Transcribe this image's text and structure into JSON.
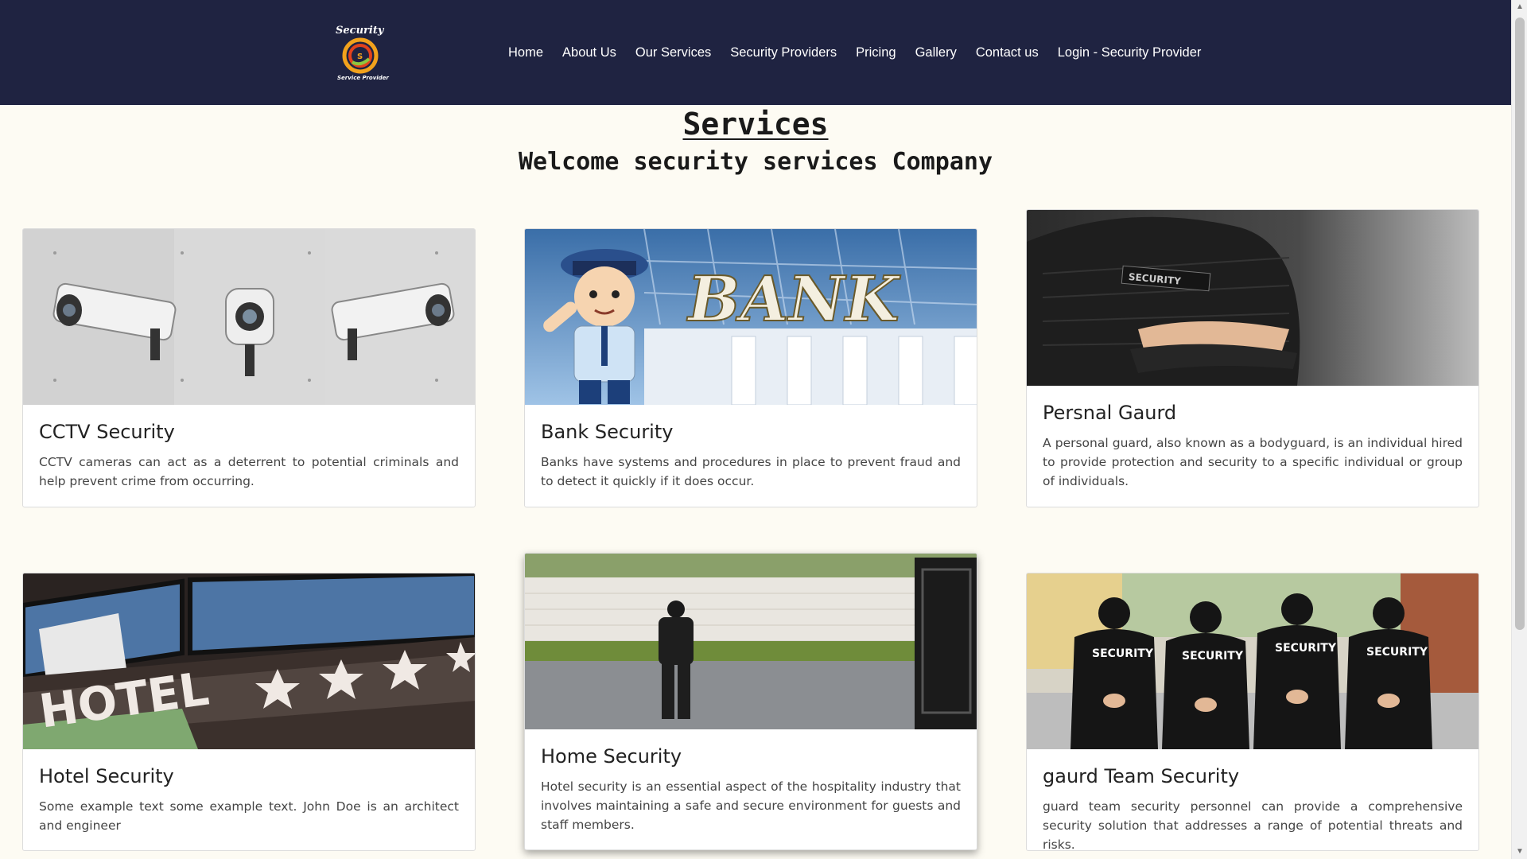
{
  "nav": {
    "logo_text": "Security",
    "logo_subtext": "Service Provider",
    "items": [
      {
        "label": "Home"
      },
      {
        "label": "About Us"
      },
      {
        "label": "Our Services"
      },
      {
        "label": "Security Providers"
      },
      {
        "label": "Pricing"
      },
      {
        "label": "Gallery"
      },
      {
        "label": "Contact us"
      },
      {
        "label": "Login - Security Provider"
      }
    ]
  },
  "page": {
    "title": "Services",
    "subtitle": "Welcome security services Company"
  },
  "cards": [
    {
      "title": "CCTV Security",
      "text": "CCTV cameras can act as a deterrent to potential criminals and help prevent crime from occurring.",
      "image": "cctv-cameras-image"
    },
    {
      "title": "Bank Security",
      "text": "Banks have systems and procedures in place to prevent fraud and to detect it quickly if it does occur.",
      "image": "bank-guard-image"
    },
    {
      "title": "Persnal Gaurd",
      "text": "A personal guard, also known as a bodyguard, is an individual hired to provide protection and security to a specific individual or group of individuals.",
      "image": "personal-guard-image"
    },
    {
      "title": "Hotel Security",
      "text": "Some example text some example text. John Doe is an architect and engineer",
      "image": "hotel-sign-image"
    },
    {
      "title": "Home Security",
      "text": "Hotel security is an essential aspect of the hospitality industry that involves maintaining a safe and secure environment for guests and staff members.",
      "image": "home-guard-image"
    },
    {
      "title": "gaurd Team Security",
      "text": "guard team security personnel can provide a comprehensive security solution that addresses a range of potential threats and risks.",
      "image": "guard-team-image"
    }
  ],
  "images": {
    "bank_sign": "BANK",
    "hotel_sign": "HOTEL",
    "security_badge": "SECURITY"
  },
  "colors": {
    "navbar_bg": "#1f2341",
    "page_bg": "#fdfbf3"
  }
}
